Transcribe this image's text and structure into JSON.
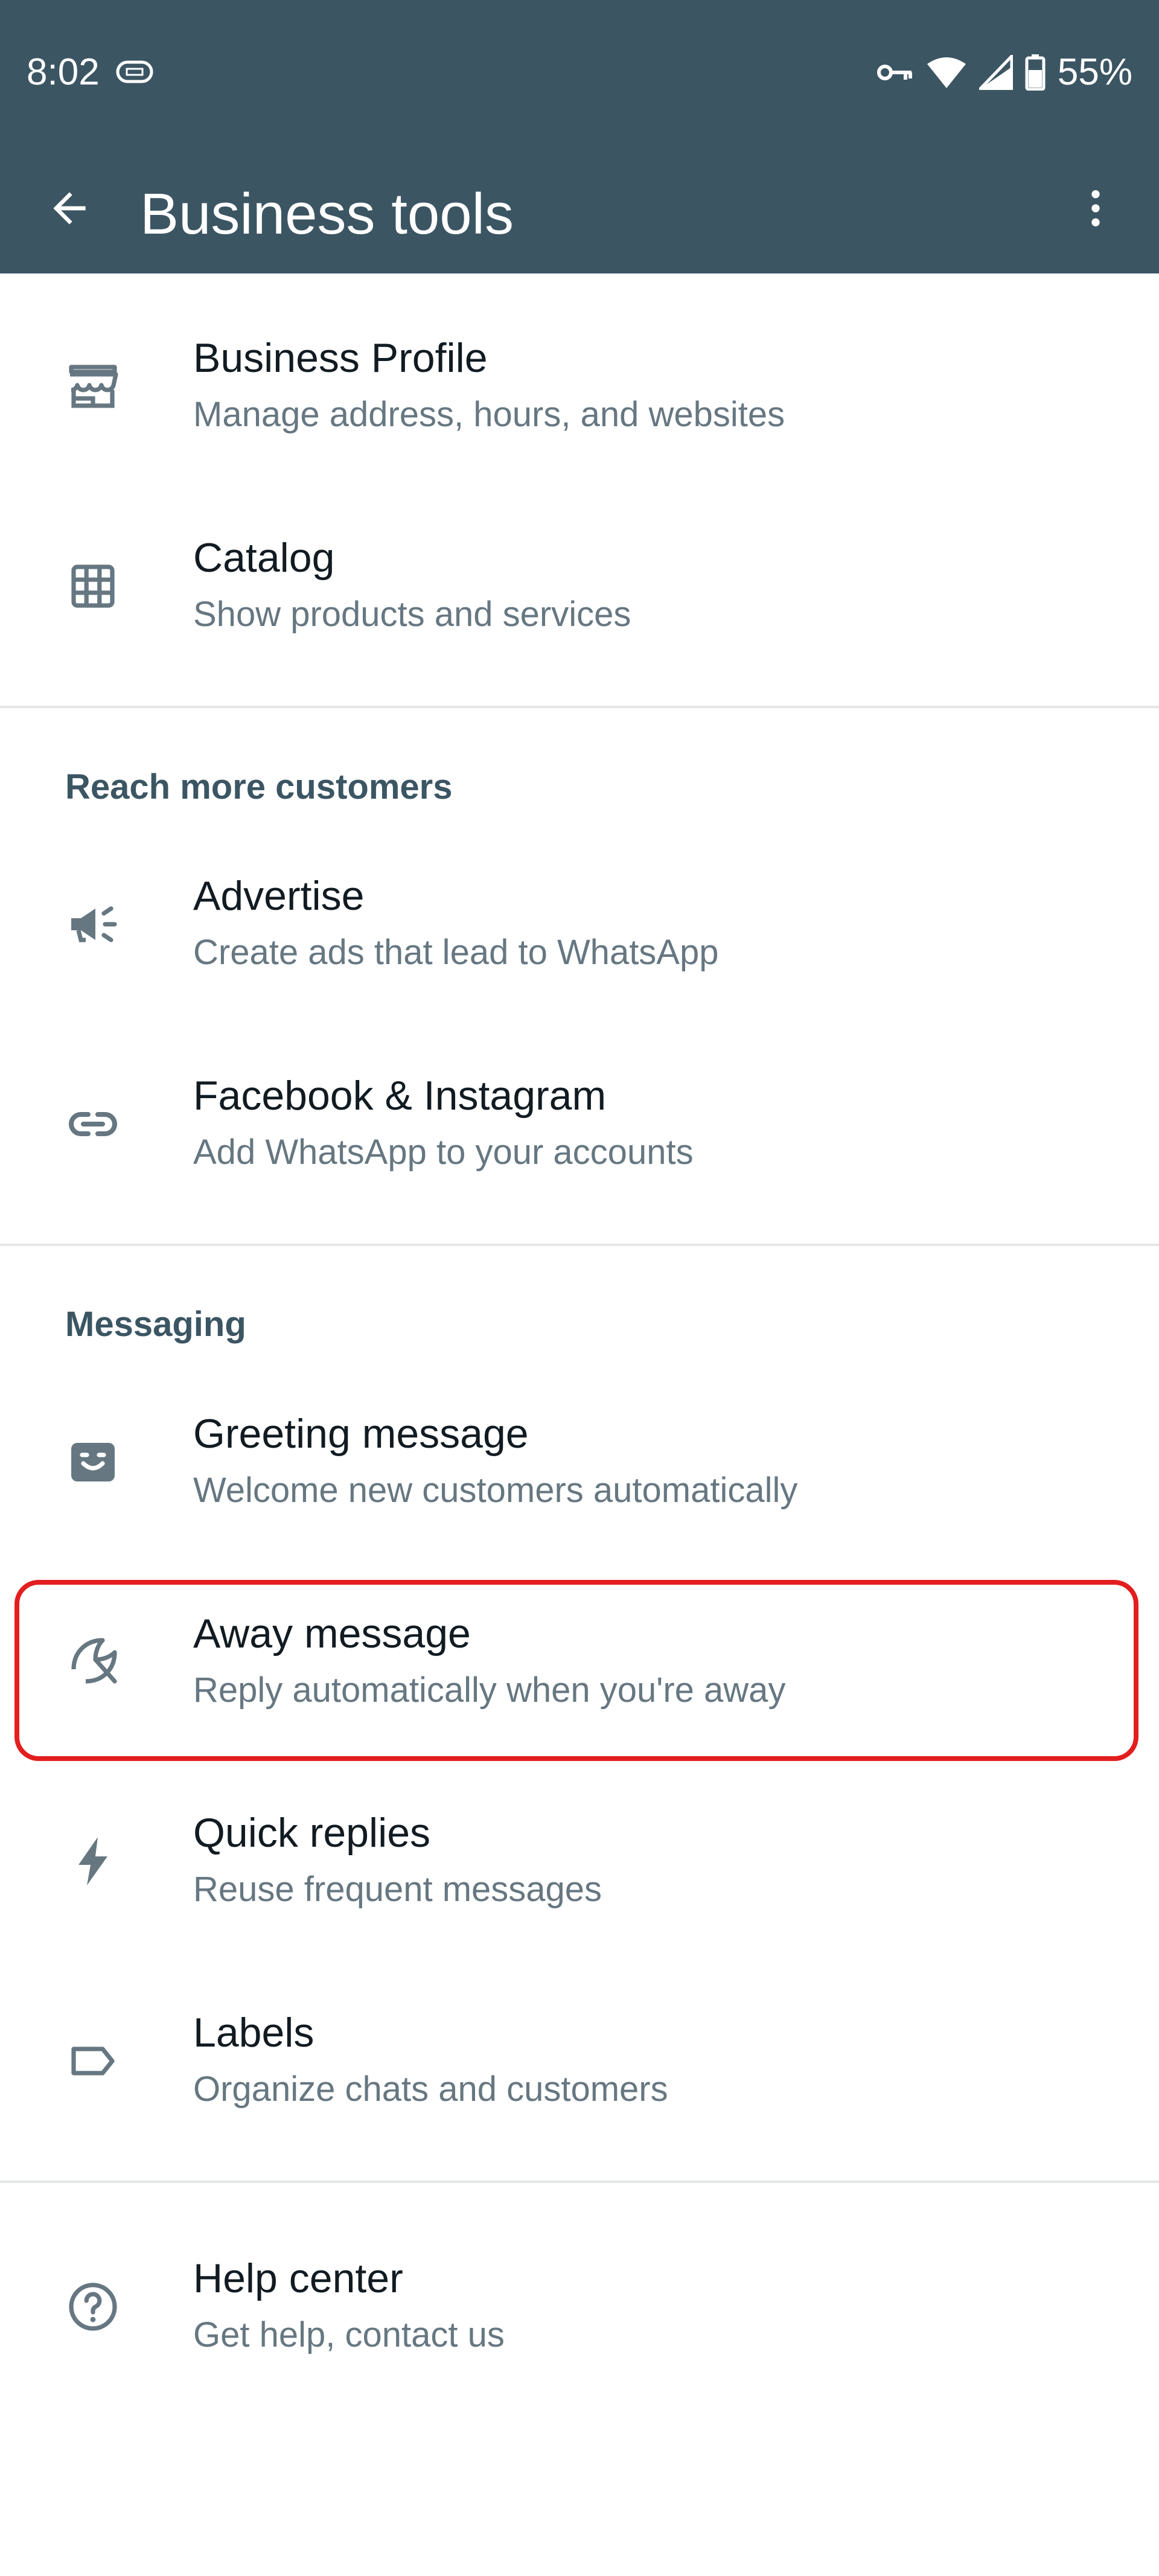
{
  "status_bar": {
    "time": "8:02",
    "battery": "55%",
    "icons": [
      "vpn-icon",
      "key-icon",
      "wifi-icon",
      "signal-icon",
      "battery-icon"
    ]
  },
  "app_bar": {
    "title": "Business tools",
    "back_icon": "arrow-back-icon",
    "more_icon": "more-vert-icon"
  },
  "items": {
    "business_profile": {
      "title": "Business Profile",
      "subtitle": "Manage address, hours, and websites",
      "icon": "storefront-icon"
    },
    "catalog": {
      "title": "Catalog",
      "subtitle": "Show products and services",
      "icon": "grid-icon"
    },
    "advertise": {
      "title": "Advertise",
      "subtitle": "Create ads that lead to WhatsApp",
      "icon": "megaphone-icon"
    },
    "facebook_instagram": {
      "title": "Facebook & Instagram",
      "subtitle": "Add WhatsApp to your accounts",
      "icon": "link-icon"
    },
    "greeting_message": {
      "title": "Greeting message",
      "subtitle": "Welcome new customers automatically",
      "icon": "greeting-icon"
    },
    "away_message": {
      "title": "Away message",
      "subtitle": "Reply automatically when you're away",
      "icon": "beach-umbrella-icon"
    },
    "quick_replies": {
      "title": "Quick replies",
      "subtitle": "Reuse frequent messages",
      "icon": "lightning-icon"
    },
    "labels": {
      "title": "Labels",
      "subtitle": "Organize chats and customers",
      "icon": "label-icon"
    },
    "help_center": {
      "title": "Help center",
      "subtitle": "Get help, contact us",
      "icon": "help-circle-icon"
    }
  },
  "sections": {
    "reach": "Reach more customers",
    "messaging": "Messaging"
  },
  "colors": {
    "header": "#3b5563",
    "icon": "#667781",
    "title_text": "#111b21",
    "subtitle_text": "#667781",
    "highlight": "#e31e1e"
  }
}
